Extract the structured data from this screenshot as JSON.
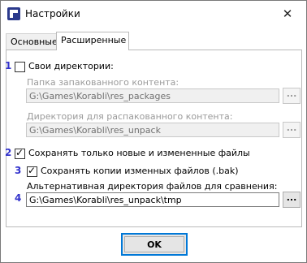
{
  "window": {
    "title": "Настройки",
    "app_icon": "app-icon",
    "close_glyph": "✕"
  },
  "tabs": [
    {
      "label": "Основные",
      "active": false
    },
    {
      "label": "Расширенные",
      "active": true
    }
  ],
  "markers": [
    "1",
    "2",
    "3",
    "4"
  ],
  "custom_dirs": {
    "label": "Свои директории:",
    "checked": false,
    "packed_label": "Папка запакованного контента:",
    "packed_value": "G:\\Games\\Korabli\\res_packages",
    "unpacked_label": "Директория для распакованного контента:",
    "unpacked_value": "G:\\Games\\Korabli\\res_unpack",
    "browse_label": "..."
  },
  "save_only_changed": {
    "label": "Сохранять только новые и измененные файлы",
    "checked": true
  },
  "save_backup": {
    "label": "Сохранять копии изменных файлов (.bak)",
    "checked": true
  },
  "compare_dir": {
    "label": "Альтернативная директория файлов для сравнения:",
    "value": "G:\\Games\\Korabli\\res_unpack\\tmp",
    "browse_label": "..."
  },
  "ok_label": "OK",
  "colors": {
    "marker": "#3333cc",
    "focus": "#0078d7"
  }
}
